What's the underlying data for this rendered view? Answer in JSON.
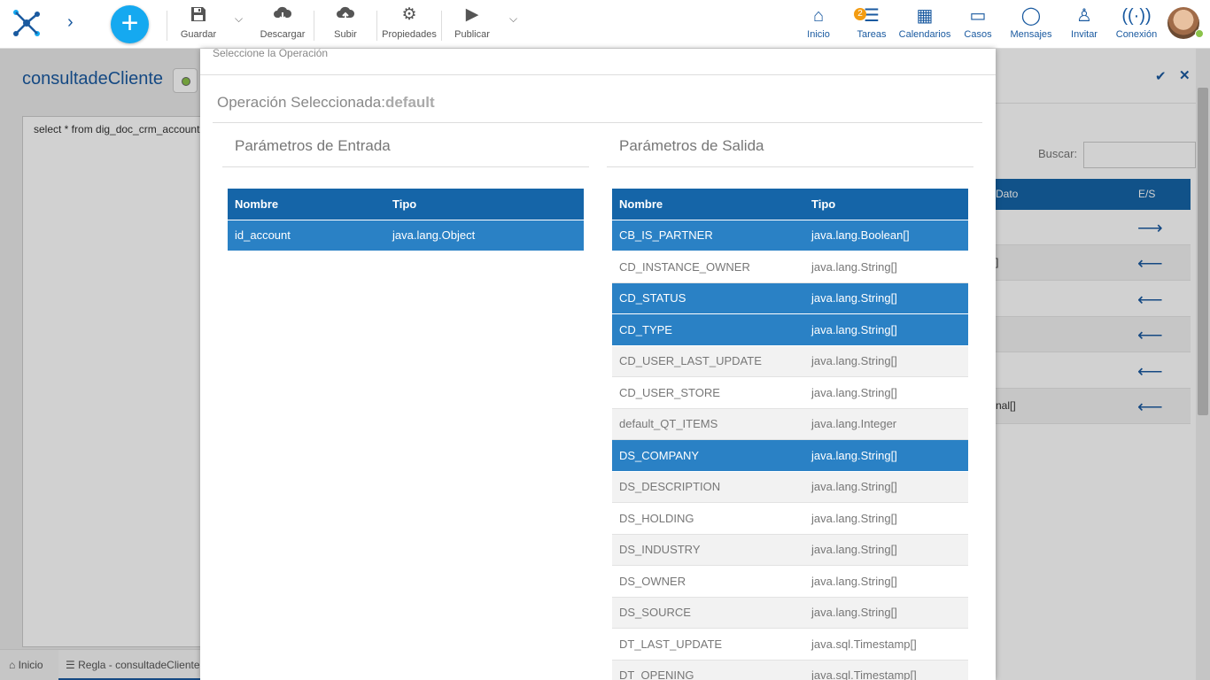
{
  "toolbar": {
    "save_label": "Guardar",
    "download_label": "Descargar",
    "upload_label": "Subir",
    "properties_label": "Propiedades",
    "publish_label": "Publicar"
  },
  "nav": {
    "home_label": "Inicio",
    "tasks_label": "Tareas",
    "tasks_badge": "2",
    "calendars_label": "Calendarios",
    "cases_label": "Casos",
    "messages_label": "Mensajes",
    "invite_label": "Invitar",
    "connection_label": "Conexión"
  },
  "background": {
    "page_title": "consultadeCliente",
    "editor_text": "select * from dig_doc_crm_account",
    "bottom_home": "Inicio",
    "bottom_tab": "Regla - consultadeCliente",
    "search_label": "Buscar:",
    "table_header_data": "Dato",
    "table_header_es": "E/S",
    "rows": [
      {
        "text": "",
        "arrow": "⟶"
      },
      {
        "text": "]",
        "arrow": "⟵"
      },
      {
        "text": "",
        "arrow": "⟵"
      },
      {
        "text": "",
        "arrow": "⟵"
      },
      {
        "text": "",
        "arrow": "⟵"
      },
      {
        "text": "nal[]",
        "arrow": "⟵"
      }
    ]
  },
  "modal": {
    "top_label": "Seleccione la Operación",
    "operation_label": "Operación Seleccionada:",
    "operation_value": "default",
    "input_title": "Parámetros de Entrada",
    "output_title": "Parámetros de Salida",
    "col_name": "Nombre",
    "col_type": "Tipo",
    "inputs": [
      {
        "name": "id_account",
        "type": "java.lang.Object",
        "selected": true
      }
    ],
    "outputs": [
      {
        "name": "CB_IS_PARTNER",
        "type": "java.lang.Boolean[]",
        "selected": true
      },
      {
        "name": "CD_INSTANCE_OWNER",
        "type": "java.lang.String[]",
        "selected": false
      },
      {
        "name": "CD_STATUS",
        "type": "java.lang.String[]",
        "selected": true
      },
      {
        "name": "CD_TYPE",
        "type": "java.lang.String[]",
        "selected": true
      },
      {
        "name": "CD_USER_LAST_UPDATE",
        "type": "java.lang.String[]",
        "selected": false
      },
      {
        "name": "CD_USER_STORE",
        "type": "java.lang.String[]",
        "selected": false
      },
      {
        "name": "default_QT_ITEMS",
        "type": "java.lang.Integer",
        "selected": false
      },
      {
        "name": "DS_COMPANY",
        "type": "java.lang.String[]",
        "selected": true
      },
      {
        "name": "DS_DESCRIPTION",
        "type": "java.lang.String[]",
        "selected": false
      },
      {
        "name": "DS_HOLDING",
        "type": "java.lang.String[]",
        "selected": false
      },
      {
        "name": "DS_INDUSTRY",
        "type": "java.lang.String[]",
        "selected": false
      },
      {
        "name": "DS_OWNER",
        "type": "java.lang.String[]",
        "selected": false
      },
      {
        "name": "DS_SOURCE",
        "type": "java.lang.String[]",
        "selected": false
      },
      {
        "name": "DT_LAST_UPDATE",
        "type": "java.sql.Timestamp[]",
        "selected": false
      },
      {
        "name": "DT_OPENING",
        "type": "java.sql.Timestamp[]",
        "selected": false
      }
    ]
  },
  "colors": {
    "accent": "#1565a8",
    "selected_row": "#2a81c5",
    "add_button": "#15a9f0",
    "badge": "#f39c12"
  }
}
